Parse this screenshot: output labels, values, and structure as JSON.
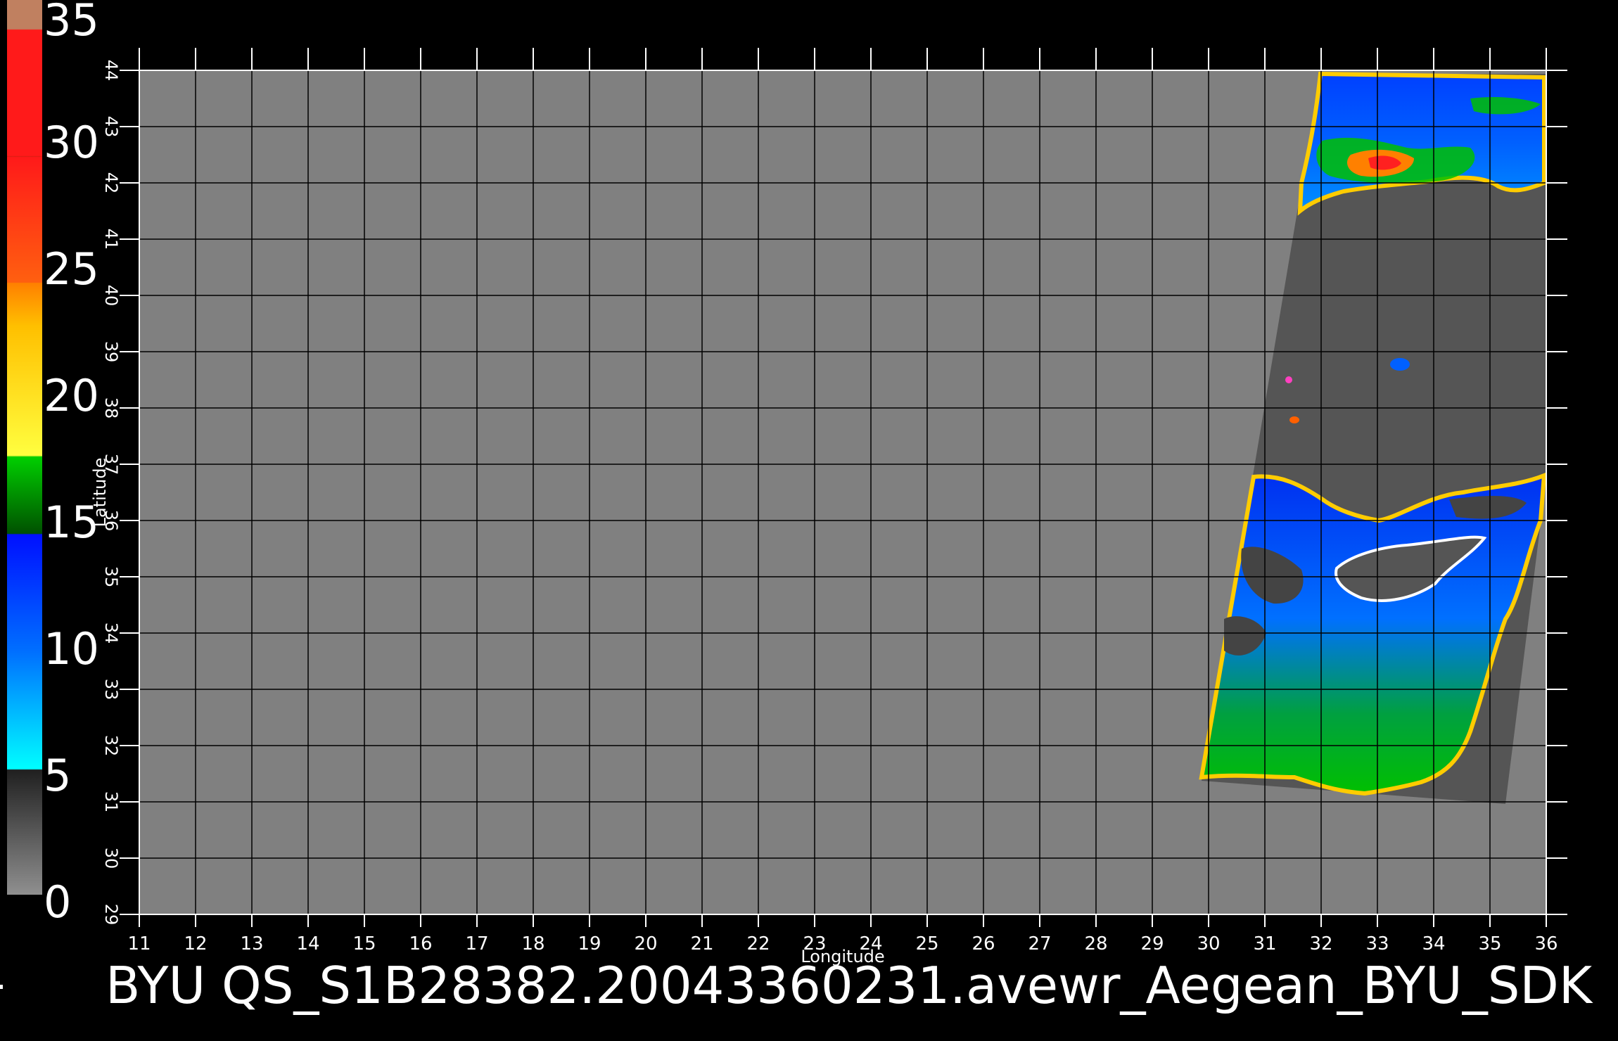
{
  "title": "BYU  QS_S1B28382.20043360231.avewr_Aegean_BYU_SDK",
  "colorbar": {
    "ticks": [
      "35",
      "30",
      "25",
      "20",
      "15",
      "10",
      "5",
      "0"
    ],
    "colors": [
      "#c08060",
      "#ff1a1a",
      "#e83010",
      "#ff8000",
      "#ffd400",
      "#ffff40",
      "#00c000",
      "#006000",
      "#0010ff",
      "#0080ff",
      "#00ffff",
      "#303030",
      "#808080"
    ]
  },
  "map_data": {
    "xlabel": "Longitude",
    "ylabel": "Latitude",
    "lon_ticks": [
      "11",
      "12",
      "13",
      "14",
      "15",
      "16",
      "17",
      "18",
      "19",
      "20",
      "21",
      "22",
      "23",
      "24",
      "25",
      "26",
      "27",
      "28",
      "29",
      "30",
      "31",
      "32",
      "33",
      "34",
      "35",
      "36"
    ],
    "lat_ticks": [
      "29",
      "30",
      "31",
      "32",
      "33",
      "34",
      "35",
      "36",
      "37",
      "38",
      "39",
      "40",
      "41",
      "42",
      "43",
      "44"
    ],
    "lon_range": [
      11,
      36
    ],
    "lat_range": [
      29,
      44
    ],
    "background_color": "#808080",
    "swath_color": "#555555",
    "land_color": "#555555"
  }
}
